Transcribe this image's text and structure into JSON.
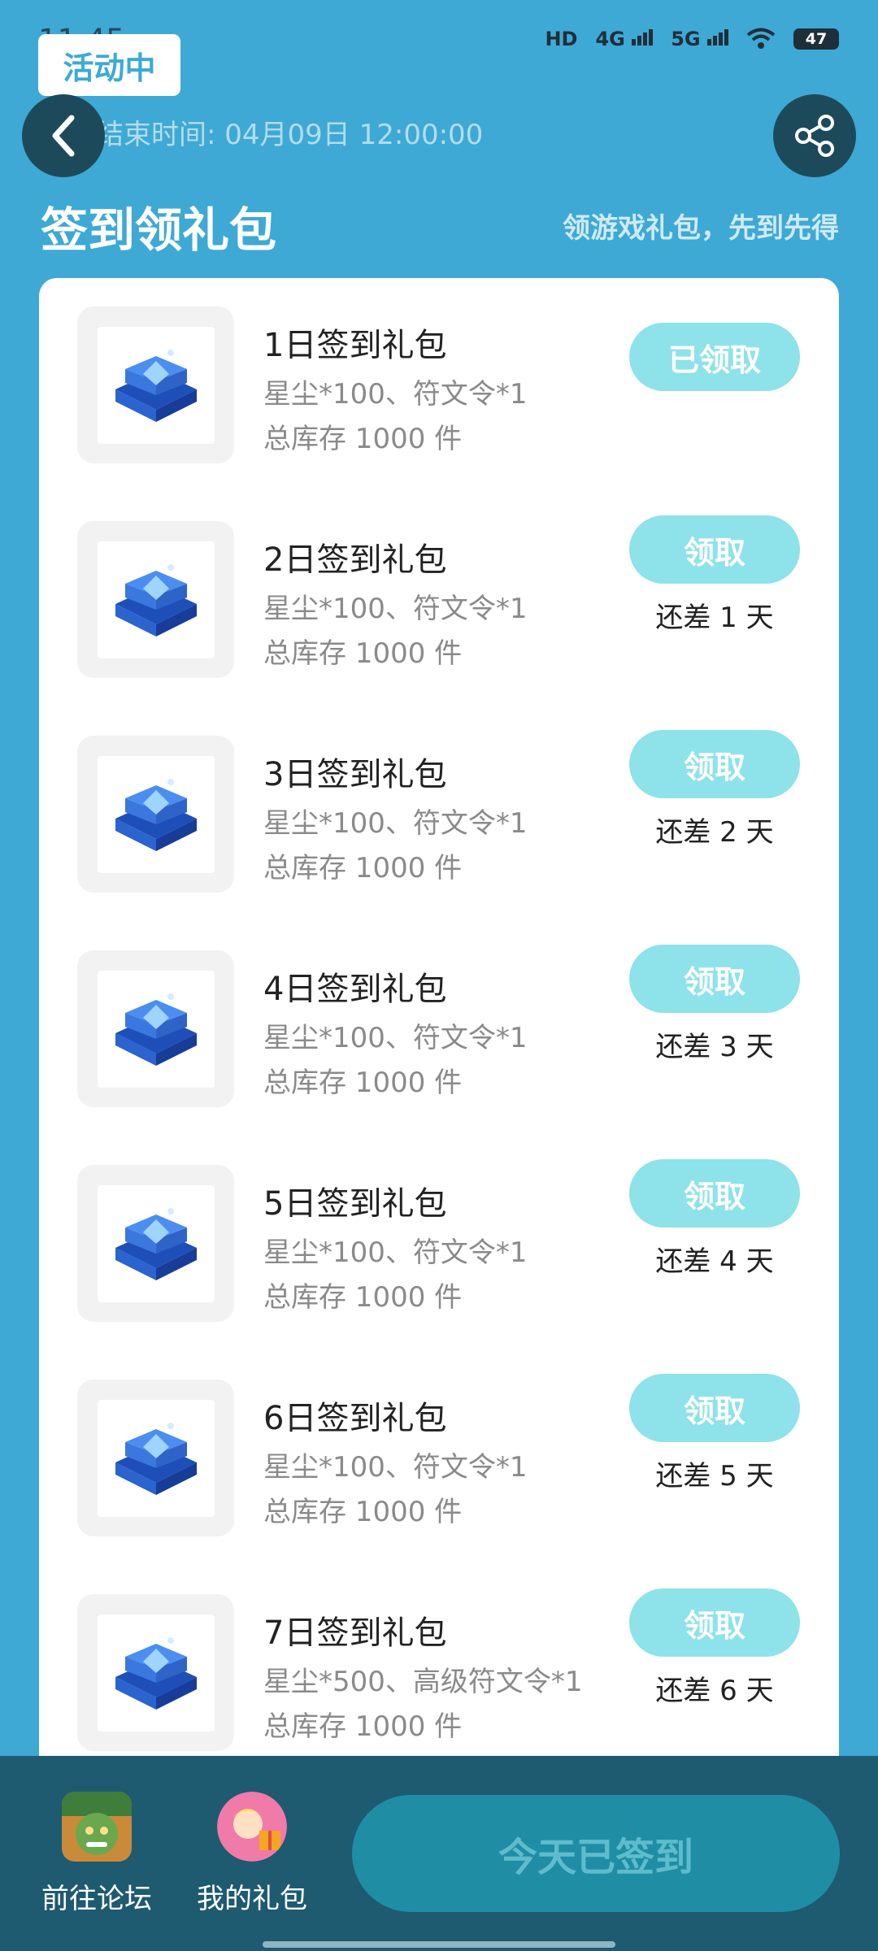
{
  "status_bar": {
    "time": "11:45",
    "battery": "47",
    "network_1": "4G",
    "network_2": "5G",
    "hd": "HD"
  },
  "header": {
    "badge": "活动中",
    "end_time": "活动结束时间: 04月09日 12:00:00",
    "section_title": "签到领礼包",
    "section_subtitle": "领游戏礼包，先到先得"
  },
  "gifts": [
    {
      "name": "1日签到礼包",
      "content": "星尘*100、符文令*1",
      "stock": "总库存 1000 件",
      "button": "已领取",
      "days_left": ""
    },
    {
      "name": "2日签到礼包",
      "content": "星尘*100、符文令*1",
      "stock": "总库存 1000 件",
      "button": "领取",
      "days_left": "还差 1 天"
    },
    {
      "name": "3日签到礼包",
      "content": "星尘*100、符文令*1",
      "stock": "总库存 1000 件",
      "button": "领取",
      "days_left": "还差 2 天"
    },
    {
      "name": "4日签到礼包",
      "content": "星尘*100、符文令*1",
      "stock": "总库存 1000 件",
      "button": "领取",
      "days_left": "还差 3 天"
    },
    {
      "name": "5日签到礼包",
      "content": "星尘*100、符文令*1",
      "stock": "总库存 1000 件",
      "button": "领取",
      "days_left": "还差 4 天"
    },
    {
      "name": "6日签到礼包",
      "content": "星尘*100、符文令*1",
      "stock": "总库存 1000 件",
      "button": "领取",
      "days_left": "还差 5 天"
    },
    {
      "name": "7日签到礼包",
      "content": "星尘*500、高级符文令*1",
      "stock": "总库存 1000 件",
      "button": "领取",
      "days_left": "还差 6 天"
    }
  ],
  "bottom_bar": {
    "forum_label": "前往论坛",
    "my_gifts_label": "我的礼包",
    "signed_button": "今天已签到"
  },
  "colors": {
    "background": "#3ea9d4",
    "button": "#8ee2ea",
    "bottom_bar": "#1e5a70",
    "signed_button": "#1f8ea5"
  }
}
